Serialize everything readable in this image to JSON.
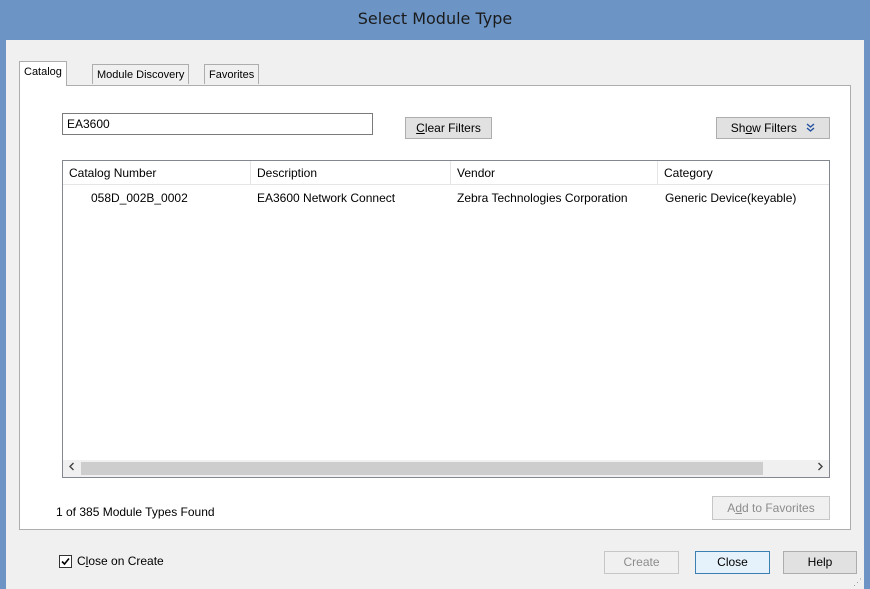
{
  "window": {
    "title": "Select Module Type"
  },
  "tabs": [
    {
      "label": "Catalog",
      "active": true
    },
    {
      "label": "Module Discovery",
      "active": false
    },
    {
      "label": "Favorites",
      "active": false
    }
  ],
  "search": {
    "value": "EA3600"
  },
  "buttons": {
    "clear_filters_pre": "",
    "clear_filters_key": "C",
    "clear_filters_post": "lear Filters",
    "show_filters_pre": "Sh",
    "show_filters_key": "o",
    "show_filters_post": "w Filters",
    "show_filters_icon": "chevron-double-down-icon",
    "add_favorites_pre": "A",
    "add_favorites_key": "d",
    "add_favorites_post": "d to Favorites",
    "create": "Create",
    "close": "Close",
    "help": "Help"
  },
  "table": {
    "columns": [
      "Catalog Number",
      "Description",
      "Vendor",
      "Category"
    ],
    "rows": [
      [
        "058D_002B_0002",
        "EA3600 Network Connect",
        "Zebra Technologies Corporation",
        "Generic Device(keyable)"
      ]
    ]
  },
  "status": {
    "text": "1 of 385 Module Types Found"
  },
  "close_on_create": {
    "checked": true,
    "label_pre": "C",
    "label_key": "l",
    "label_post": "ose on Create"
  },
  "colors": {
    "titlebar": "#6c95c6",
    "client": "#f0f0f0"
  }
}
